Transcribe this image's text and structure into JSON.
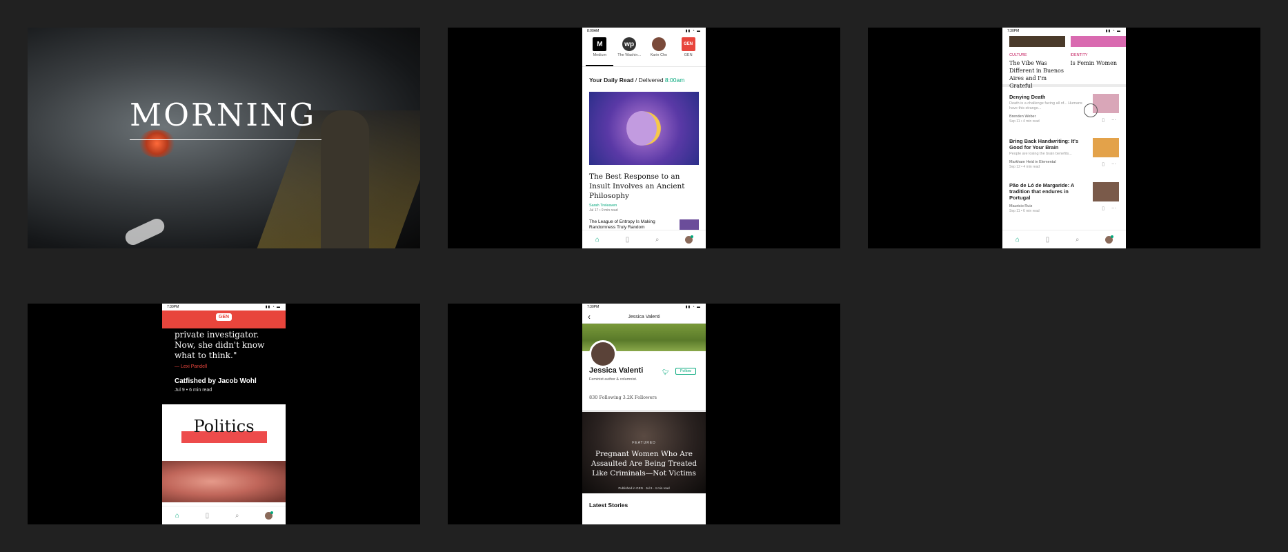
{
  "tile1": {
    "title": "MORNING"
  },
  "tile2": {
    "status_time": "8:00AM",
    "publications": [
      {
        "logo": "M",
        "label": "Medium",
        "color": "#000000"
      },
      {
        "logo": "wp",
        "label": "The Washin...",
        "color": "#333333"
      },
      {
        "logo": "",
        "label": "Karin Cho",
        "color": "#7a4a3a"
      },
      {
        "logo": "GEN",
        "label": "GEN",
        "color": "#e8453c"
      }
    ],
    "daily_read": "Your Daily Read",
    "delivered": " / Delivered ",
    "delivered_time": "8:00am",
    "headline": "The Best Response to an Insult Involves an Ancient Philosophy",
    "author": "Sarah Treleaven",
    "meta": "Jul 17 • 9 min read",
    "next_story": "The League of Entropy Is Making Randomness Truly Random"
  },
  "tile3": {
    "status_time": "7:30PM",
    "cards": [
      {
        "category": "CULTURE",
        "title": "The Vibe Was Different in Buenos Aires and I'm Grateful"
      },
      {
        "category": "IDENTITY",
        "title": "Is Femin Women"
      }
    ],
    "stories": [
      {
        "title": "Denying Death",
        "subtitle": "Death is a challenge facing all of... Humans have this strange...",
        "author": "Brenden Weber",
        "date": "Sep 11 • 4 min read",
        "img_color": "#d9a6b8"
      },
      {
        "title": "Bring Back Handwriting: It's Good for Your Brain",
        "subtitle": "People are losing the brain benefits...",
        "author": "Markham Heid in Elemental",
        "date": "Sep 12 • 4 min read",
        "img_color": "#e3a24a"
      },
      {
        "title": "Pão de Ló de Margaride: A tradition that endures in Portugal",
        "subtitle": "",
        "author": "Mauricio Ruiz",
        "date": "Sep 11 • 6 min read",
        "img_color": "#7a5a4a"
      }
    ]
  },
  "tile4": {
    "status_time": "7:30PM",
    "logo": "GEN",
    "quote": "private investigator. Now, she didn't know what to think.\"",
    "quote_author": "— Lexi Pandell",
    "article_title": "Catfished by Jacob Wohl",
    "article_meta": "Jul 9  •  6 min read",
    "section": "Politics"
  },
  "tile5": {
    "status_time": "7:30PM",
    "header_name": "Jessica Valenti",
    "name": "Jessica Valenti",
    "bio": "Feminist author & columnist.",
    "follow": "Follow",
    "stats": "830 Following    3.2K Followers",
    "featured_label": "FEATURED",
    "featured_title": "Pregnant Women Who Are Assaulted Are Being Treated Like Criminals—Not Victims",
    "featured_meta": "Published in GEN · Jul 9 · 4 min read",
    "latest": "Latest Stories"
  }
}
